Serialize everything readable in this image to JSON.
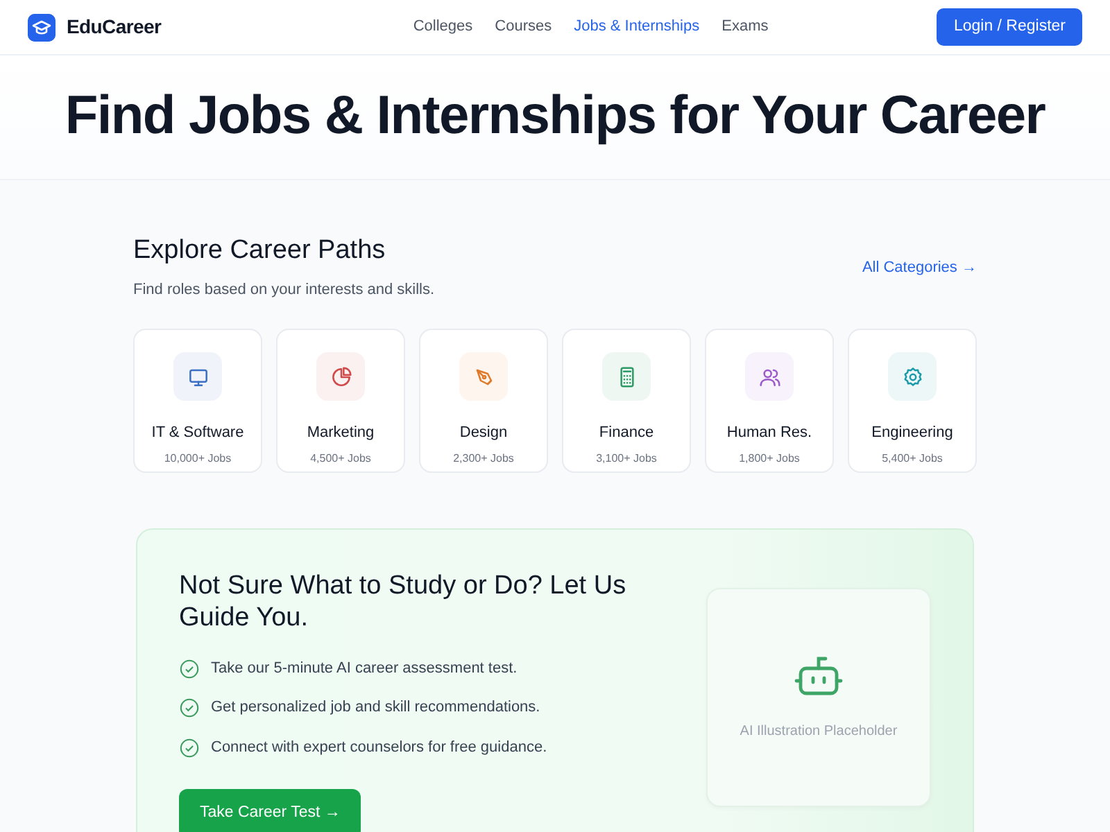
{
  "brand": "EduCareer",
  "nav": [
    {
      "label": "Colleges",
      "selected": false
    },
    {
      "label": "Courses",
      "selected": false
    },
    {
      "label": "Jobs & Internships",
      "selected": true
    },
    {
      "label": "Exams",
      "selected": false
    }
  ],
  "login_button": "Login / Register",
  "hero_title": "Find Jobs & Internships for Your Career",
  "section": {
    "title": "Explore Career Paths",
    "subtitle": "Find roles based on your interests and skills.",
    "link": "All Categories →"
  },
  "categories": [
    {
      "name": "IT & Software",
      "count": "10,000+ Jobs",
      "color": "#3b6fc4"
    },
    {
      "name": "Marketing",
      "count": "4,500+ Jobs",
      "color": "#d04a4a"
    },
    {
      "name": "Design",
      "count": "2,300+ Jobs",
      "color": "#e07a2a"
    },
    {
      "name": "Finance",
      "count": "3,100+ Jobs",
      "color": "#2e9a66"
    },
    {
      "name": "Human Res.",
      "count": "1,800+ Jobs",
      "color": "#9b59c9"
    },
    {
      "name": "Engineering",
      "count": "5,400+ Jobs",
      "color": "#1a9aa8"
    }
  ],
  "promo": {
    "title": "Not Sure What to Study or Do? Let Us Guide You.",
    "points": [
      "Take our 5-minute AI career assessment test.",
      "Get personalized job and skill recommendations.",
      "Connect with expert counselors for free guidance."
    ],
    "button": "Take Career Test →",
    "placeholder": "AI Illustration Placeholder"
  }
}
